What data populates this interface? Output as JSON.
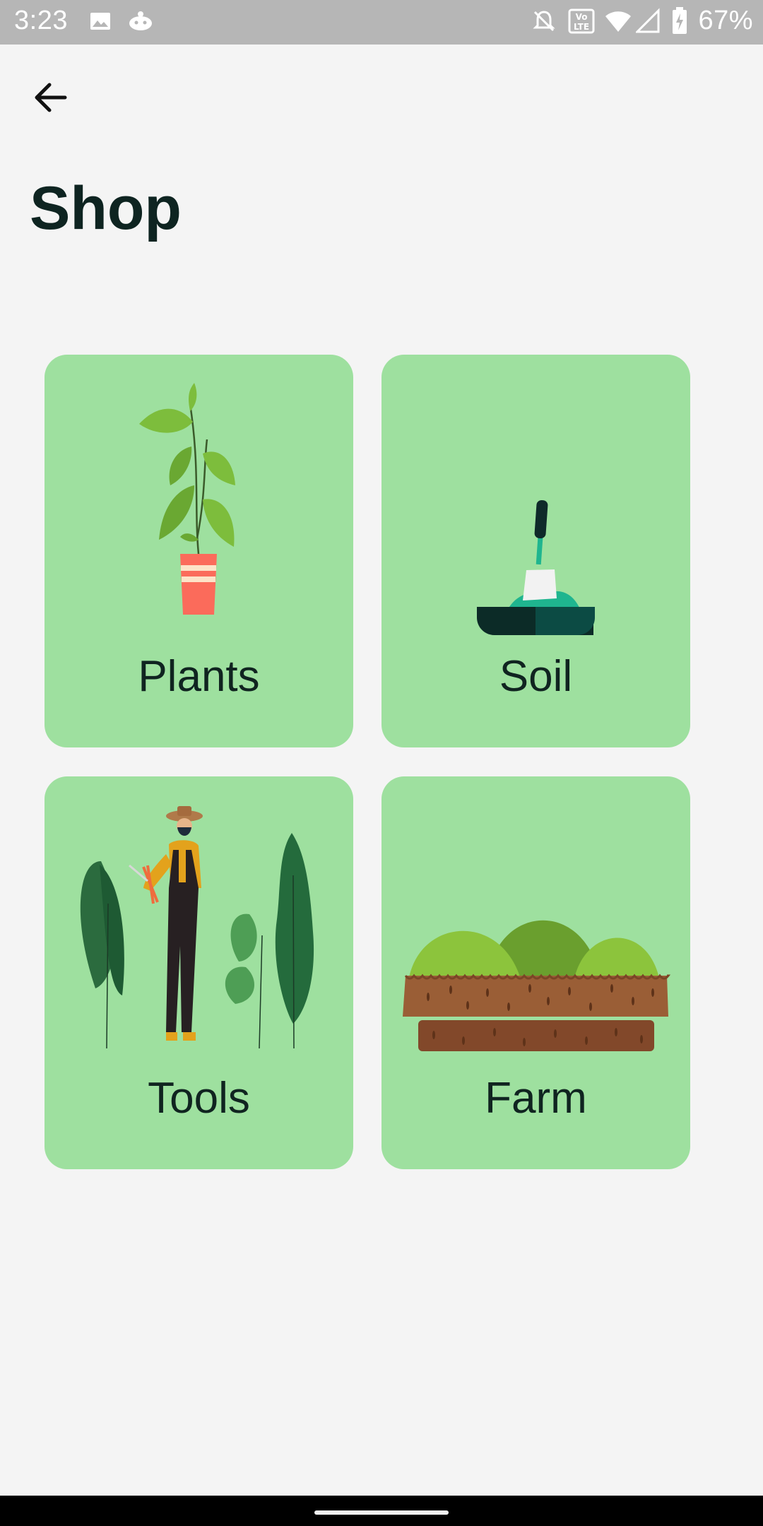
{
  "status_bar": {
    "time": "3:23",
    "battery": "67%",
    "icons": [
      "image-icon",
      "cat-icon",
      "bell-off-icon",
      "volte-icon",
      "wifi-icon",
      "signal-icon",
      "battery-charging-icon"
    ]
  },
  "header": {
    "back_icon": "arrow-back-icon",
    "title": "Shop"
  },
  "categories": [
    {
      "label": "Plants",
      "icon": "potted-plant-illustration"
    },
    {
      "label": "Soil",
      "icon": "shovel-soil-illustration"
    },
    {
      "label": "Tools",
      "icon": "gardener-illustration"
    },
    {
      "label": "Farm",
      "icon": "farm-field-illustration"
    }
  ],
  "colors": {
    "card_background": "#9ee09f",
    "page_background": "#f4f4f4",
    "title_color": "#0e2421",
    "status_bar": "#b6b6b6"
  }
}
